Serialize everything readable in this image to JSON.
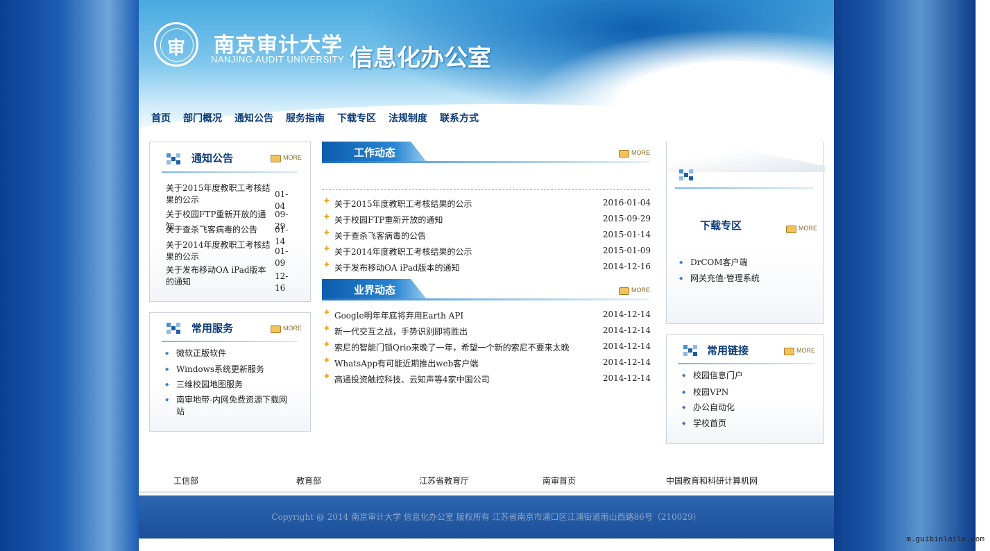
{
  "header": {
    "university_cn": "南京审计大学",
    "university_en": "NANJING AUDIT UNIVERSITY",
    "office": "信息化办公室"
  },
  "nav": [
    "首页",
    "部门概况",
    "通知公告",
    "服务指南",
    "下载专区",
    "法规制度",
    "联系方式"
  ],
  "more_label": "MORE",
  "notices": {
    "title": "通知公告",
    "items": [
      {
        "title": "关于2015年度教职工考核结果的公示",
        "date": "01-04"
      },
      {
        "title": "关于校园FTP重新开放的通知",
        "date": "09-29"
      },
      {
        "title": "关于查杀飞客病毒的公告",
        "date": "01-14"
      },
      {
        "title": "关于2014年度教职工考核结果的公示",
        "date": "01-09"
      },
      {
        "title": "关于发布移动OA iPad版本的通知",
        "date": "12-16"
      }
    ]
  },
  "services": {
    "title": "常用服务",
    "items": [
      "微软正版软件",
      "Windows系统更新服务",
      "三维校园地图服务",
      "南审地带-内网免费资源下载网站"
    ]
  },
  "work_news": {
    "title": "工作动态",
    "items": [
      {
        "title": "关于2015年度教职工考核结果的公示",
        "date": "2016-01-04"
      },
      {
        "title": "关于校园FTP重新开放的通知",
        "date": "2015-09-29"
      },
      {
        "title": "关于查杀飞客病毒的公告",
        "date": "2015-01-14"
      },
      {
        "title": "关于2014年度教职工考核结果的公示",
        "date": "2015-01-09"
      },
      {
        "title": "关于发布移动OA iPad版本的通知",
        "date": "2014-12-16"
      }
    ]
  },
  "industry_news": {
    "title": "业界动态",
    "items": [
      {
        "title": "Google明年年底将弃用Earth API",
        "date": "2014-12-14"
      },
      {
        "title": "新一代交互之战，手势识别即将胜出",
        "date": "2014-12-14"
      },
      {
        "title": "索尼的智能门锁Qrio来晚了一年，希望一个新的索尼不要来太晚",
        "date": "2014-12-14"
      },
      {
        "title": "WhatsApp有可能近期推出web客户端",
        "date": "2014-12-14"
      },
      {
        "title": "高通投资触控科技、云知声等4家中国公司",
        "date": "2014-12-14"
      }
    ]
  },
  "downloads": {
    "title": "下载专区",
    "items": [
      "DrCOM客户端",
      "网关充值·管理系统"
    ]
  },
  "links": {
    "title": "常用链接",
    "items": [
      "校园信息门户",
      "校园VPN",
      "办公自动化",
      "学校首页"
    ]
  },
  "footer_links": [
    "工信部",
    "教育部",
    "江苏省教育厅",
    "南审首页",
    "中国教育和科研计算机网"
  ],
  "copyright": "Copyright @ 2014 南京审计大学  信息化办公室  版权所有  江苏省南京市浦口区江浦街道雨山西路86号（210029）",
  "watermark": "m.guibinlaile.com"
}
